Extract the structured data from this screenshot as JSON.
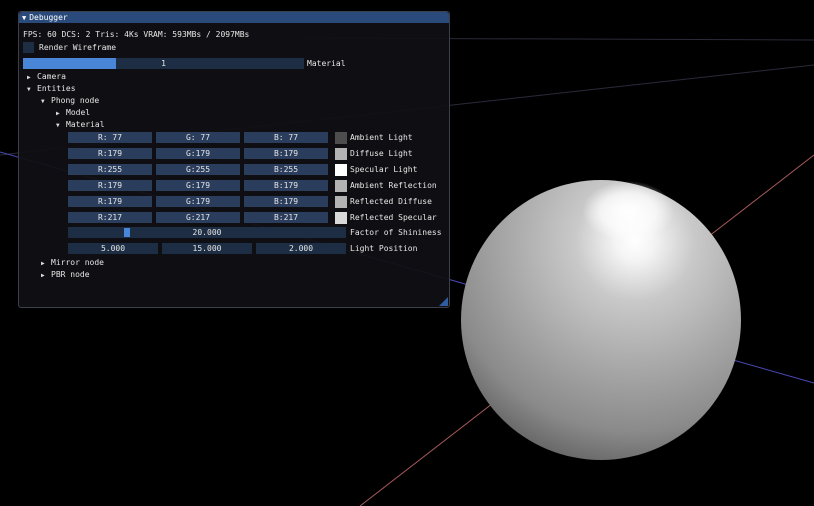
{
  "window": {
    "title": "Debugger",
    "stats": "FPS: 60 DCS: 2 Tris: 4Ks  VRAM: 593MBs / 2097MBs",
    "render_wireframe_label": "Render Wireframe",
    "material_slider": {
      "value": "1",
      "label": "Material",
      "fill_fraction": 0.33
    },
    "tree": {
      "camera": "Camera",
      "entities": "Entities",
      "phong_node": "Phong node",
      "model": "Model",
      "material": "Material",
      "mirror_node": "Mirror node",
      "pbr_node": "PBR node"
    },
    "material_rows": [
      {
        "r": "R: 77",
        "g": "G: 77",
        "b": "B: 77",
        "label": "Ambient Light",
        "color": "#4d4d4d"
      },
      {
        "r": "R:179",
        "g": "G:179",
        "b": "B:179",
        "label": "Diffuse Light",
        "color": "#b3b3b3"
      },
      {
        "r": "R:255",
        "g": "G:255",
        "b": "B:255",
        "label": "Specular Light",
        "color": "#ffffff"
      },
      {
        "r": "R:179",
        "g": "G:179",
        "b": "B:179",
        "label": "Ambient Reflection",
        "color": "#b3b3b3"
      },
      {
        "r": "R:179",
        "g": "G:179",
        "b": "B:179",
        "label": "Reflected Diffuse",
        "color": "#b3b3b3"
      },
      {
        "r": "R:217",
        "g": "G:217",
        "b": "B:217",
        "label": "Reflected Specular",
        "color": "#d9d9d9"
      }
    ],
    "shininess": {
      "value": "20.000",
      "label": "Factor of Shininess",
      "fraction": 0.2
    },
    "light_position": {
      "x": "5.000",
      "y": "15.000",
      "z": "2.000",
      "label": "Light Position"
    }
  },
  "colors": {
    "title_bar": "#294a7a",
    "accent": "#4a86d8",
    "frame_bg": "#1d2d44",
    "field_bg": "#2a3d5c",
    "sphere": "#b3b3b3"
  }
}
